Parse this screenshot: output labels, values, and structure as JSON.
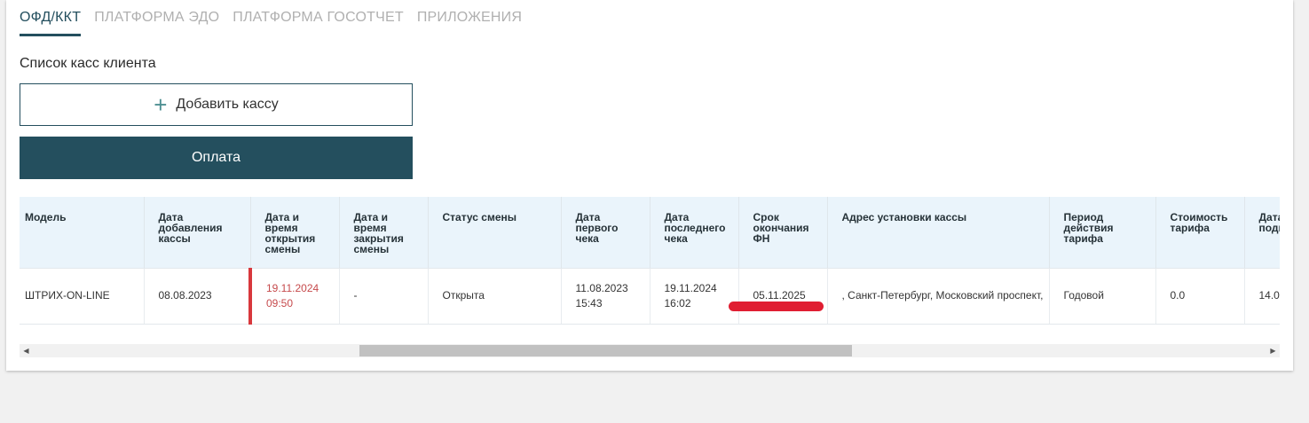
{
  "tabs": [
    {
      "label": "ОФД/ККТ",
      "active": true
    },
    {
      "label": "ПЛАТФОРМА ЭДО",
      "active": false
    },
    {
      "label": "ПЛАТФОРМА ГОСОТЧЕТ",
      "active": false
    },
    {
      "label": "ПРИЛОЖЕНИЯ",
      "active": false
    }
  ],
  "section_title": "Список касс клиента",
  "buttons": {
    "add_kassa": "Добавить кассу",
    "pay": "Оплата"
  },
  "table": {
    "headers": [
      "Модель",
      "Дата добавления кассы",
      "Дата и время открытия смены",
      "Дата и время закрытия смены",
      "Статус смены",
      "Дата первого чека",
      "Дата последнего чека",
      "Срок окончания ФН",
      "Адрес установки кассы",
      "Период действия тарифа",
      "Стоимость тарифа",
      "Дата подключения"
    ],
    "rows": [
      {
        "model": "ШТРИХ-ON-LINE",
        "date_added": "08.08.2023",
        "shift_open_date": "19.11.2024",
        "shift_open_time": "09:50",
        "shift_close": "-",
        "shift_status": "Открыта",
        "first_check_date": "11.08.2023",
        "first_check_time": "15:43",
        "last_check_date": "19.11.2024",
        "last_check_time": "16:02",
        "fn_expiry": "05.11.2025",
        "address": ", Санкт-Петербург, Московский проспект,",
        "tariff_period": "Годовой",
        "tariff_cost": "0.0",
        "connection": "14.0"
      }
    ]
  },
  "colors": {
    "accent": "#244f5e",
    "header_bg": "#eaf4fb",
    "alert_red": "#d8383d"
  }
}
